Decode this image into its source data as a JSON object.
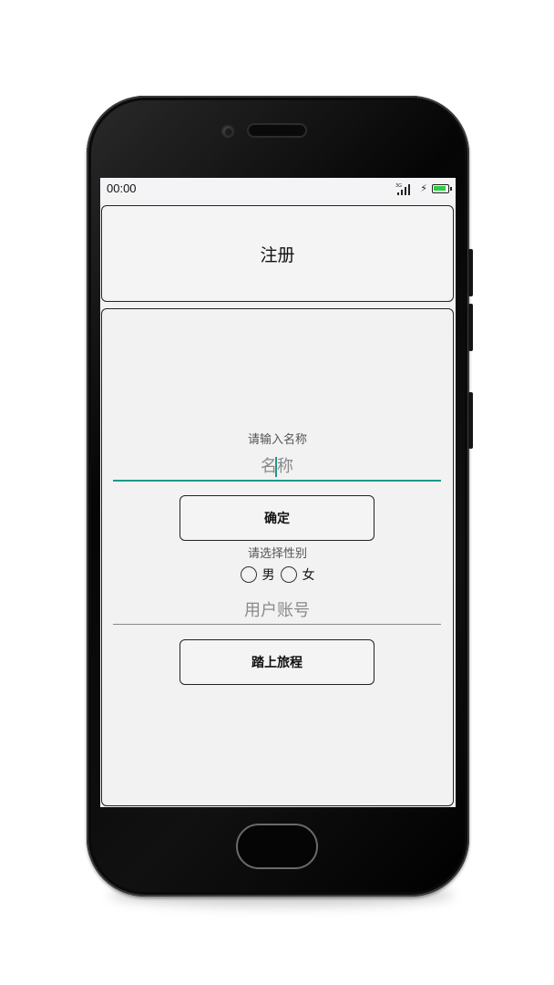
{
  "status_bar": {
    "time": "00:00",
    "network_label": "3G",
    "icons": [
      "signal-icon",
      "charging-bolt-icon",
      "battery-icon"
    ]
  },
  "title_card": {
    "title": "注册"
  },
  "name_section": {
    "prompt": "请输入名称",
    "input_placeholder": "名称",
    "input_value": "",
    "focused": true,
    "confirm_label": "确定"
  },
  "gender_section": {
    "prompt": "请选择性别",
    "options": [
      {
        "label": "男",
        "checked": false
      },
      {
        "label": "女",
        "checked": false
      }
    ]
  },
  "account_section": {
    "input_placeholder": "用户账号",
    "input_value": "",
    "start_label": "踏上旅程"
  },
  "colors": {
    "focus_accent": "#1b9a8c",
    "screen_background": "#f2f2f2",
    "battery": "#2ecc40"
  }
}
